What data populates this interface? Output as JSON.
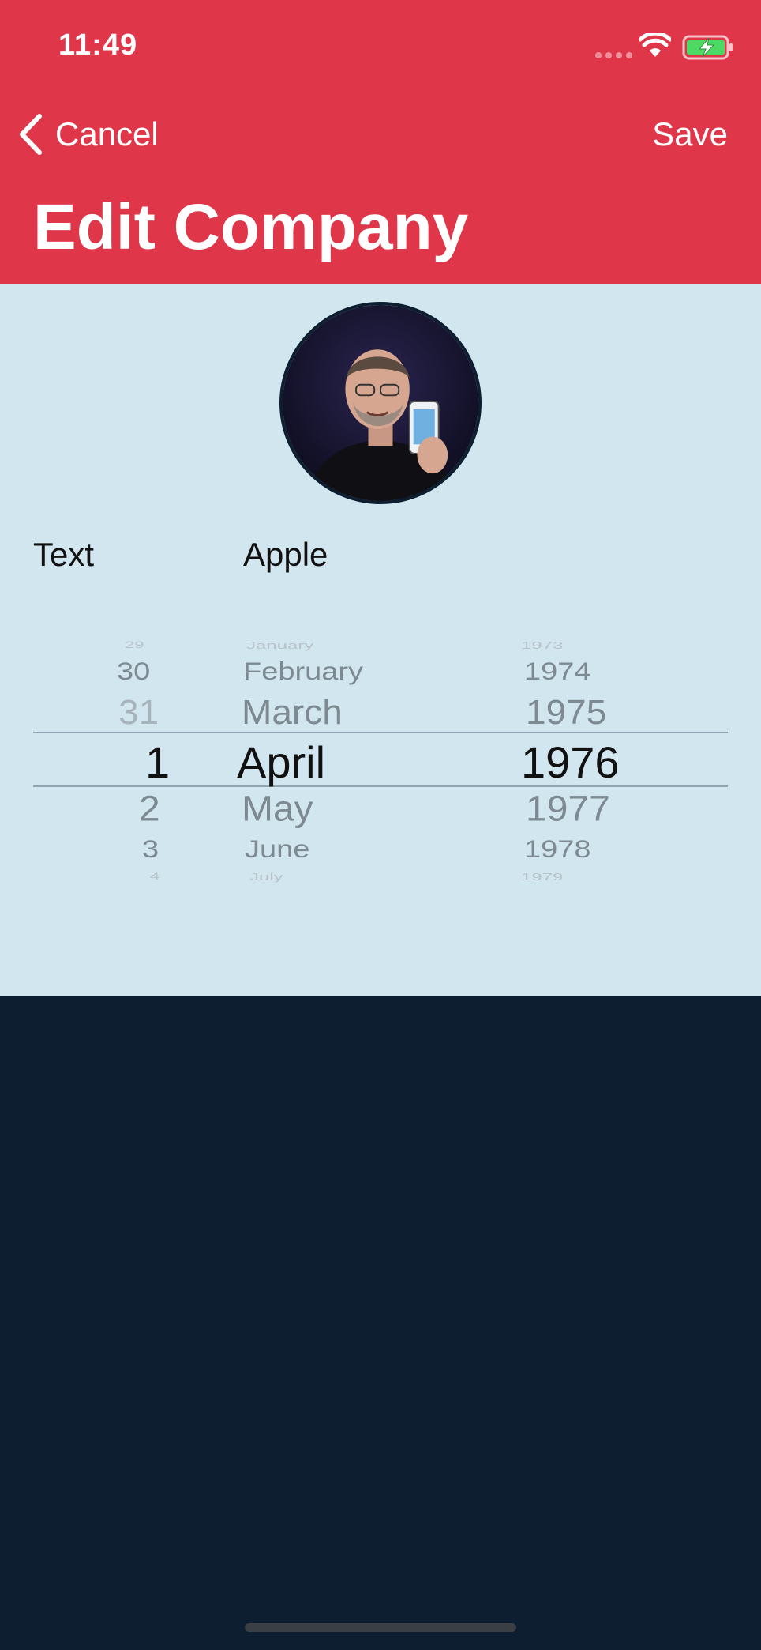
{
  "status_bar": {
    "time": "11:49",
    "wifi_icon": "wifi-icon",
    "battery_icon": "battery-charging-icon"
  },
  "nav": {
    "cancel_label": "Cancel",
    "save_label": "Save",
    "back_icon": "chevron-left-icon",
    "title": "Edit Company"
  },
  "form": {
    "name_label": "Text",
    "name_value": "Apple",
    "avatar_icon": "company-photo"
  },
  "date_picker": {
    "days": [
      "29",
      "30",
      "31",
      "1",
      "2",
      "3",
      "4"
    ],
    "months": [
      "January",
      "February",
      "March",
      "April",
      "May",
      "June",
      "July"
    ],
    "years": [
      "1973",
      "1974",
      "1975",
      "1976",
      "1977",
      "1978",
      "1979"
    ],
    "selected": {
      "day": "1",
      "month": "April",
      "year": "1976"
    }
  },
  "colors": {
    "header": "#e0364a",
    "content": "#d2e6f0",
    "background": "#0c1e30"
  }
}
